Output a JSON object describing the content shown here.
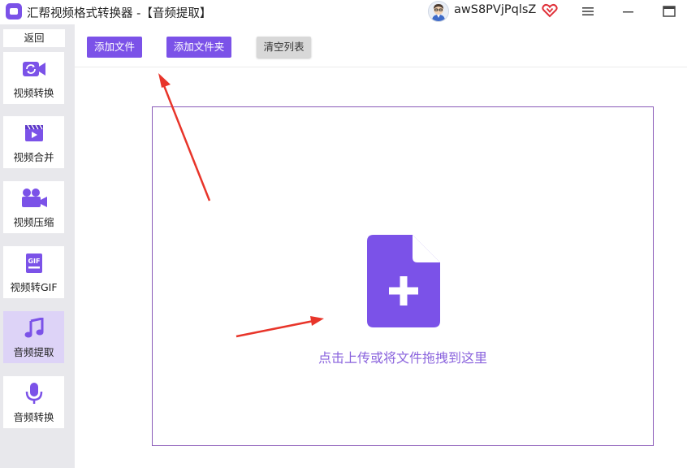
{
  "window": {
    "title": "汇帮视频格式转换器   -【音频提取】",
    "user_name": "awS8PVjPqlsZ",
    "icons": {
      "logo": "app-logo-icon",
      "avatar": "user-avatar-icon",
      "vip": "vip-heart-icon",
      "menu": "hamburger-menu-icon",
      "minimize": "minimize-icon",
      "maximize": "maximize-icon"
    }
  },
  "sidebar": {
    "back_label": "返回",
    "items": [
      {
        "label": "视频转换",
        "icon": "video-convert-icon"
      },
      {
        "label": "视频合并",
        "icon": "video-merge-icon"
      },
      {
        "label": "视频压缩",
        "icon": "video-compress-icon"
      },
      {
        "label": "视频转GIF",
        "icon": "gif-icon"
      },
      {
        "label": "音频提取",
        "icon": "music-note-icon",
        "active": true
      },
      {
        "label": "音频转换",
        "icon": "microphone-icon"
      }
    ]
  },
  "toolbar": {
    "add_file_label": "添加文件",
    "add_folder_label": "添加文件夹",
    "clear_list_label": "清空列表"
  },
  "dropzone": {
    "hint": "点击上传或将文件拖拽到这里",
    "icon": "file-plus-icon"
  },
  "colors": {
    "accent": "#7b52e8",
    "active_nav": "#ddd3f7",
    "sidebar_bg": "#e8e8ec",
    "arrow": "#e8352a",
    "hint_text": "#8a63dd"
  }
}
